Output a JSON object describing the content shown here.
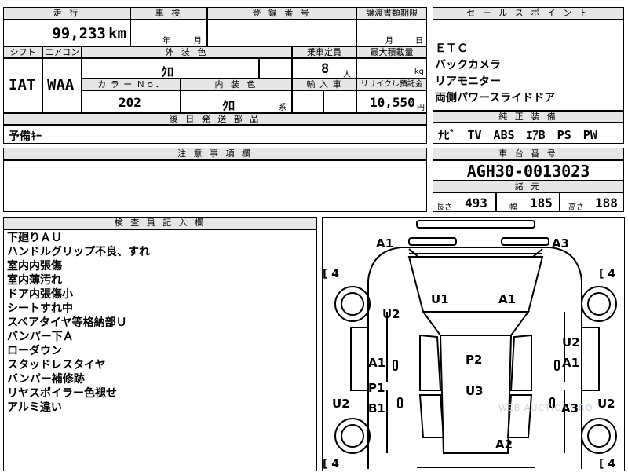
{
  "top": {
    "mileage_header": "走 行",
    "mileage_value": "99,233",
    "mileage_unit": "km",
    "inspection_header": "車 検",
    "inspection_year_label": "年",
    "inspection_month_label": "月",
    "registration_header": "登 録 番 号",
    "transfer_header": "譲渡書類期限",
    "transfer_month_label": "月",
    "transfer_day_label": "日",
    "shift_header": "シフト",
    "shift_value": "IAT",
    "aircon_header": "エアコン",
    "aircon_value": "WAA",
    "exterior_color_header": "外 装 色",
    "exterior_color_value": "ｸﾛ",
    "capacity_header": "乗車定員",
    "capacity_value": "8",
    "capacity_unit": "人",
    "max_load_header": "最大積載量",
    "max_load_unit": "kg",
    "color_no_header": "カ ラ ー Ｎｏ．",
    "color_no_value": "202",
    "interior_color_header": "内 装 色",
    "interior_color_value": "ｸﾛ",
    "interior_color_suffix": "系",
    "import_header": "輸 入 車",
    "recycle_header": "リサイクル預託金",
    "recycle_value": "10,550",
    "recycle_unit": "円",
    "parts_header": "後 日 発 送 部 品",
    "parts_value": "予備ｷｰ"
  },
  "sales": {
    "header": "セ ー ル ス ポ イ ン ト",
    "items": [
      "ＥＴＣ",
      "バックカメラ",
      "リアモニター",
      "両側パワースライドドア"
    ]
  },
  "equipment": {
    "header": "純 正 装 備",
    "value": "ﾅﾋﾞ　TV　ABS　ｴｱB　PS　PW"
  },
  "notes": {
    "header": "注 意 事 項 欄"
  },
  "chassis": {
    "header": "車 台 番 号",
    "value": "AGH30-0013023"
  },
  "dimensions": {
    "header": "諸 元",
    "length_label": "長さ",
    "length_value": "493",
    "width_label": "幅",
    "width_value": "185",
    "height_label": "高さ",
    "height_value": "188"
  },
  "inspector": {
    "header": "検 査 員 記 入 欄",
    "lines": [
      "下廻りＡＵ",
      "ハンドルグリップ不良、すれ",
      "室内内張傷",
      "室内薄汚れ",
      "ドア内張傷小",
      "シートすれ中",
      "スペアタイヤ等格納部Ｕ",
      "バンパー下Ａ",
      "ローダウン",
      "スタッドレスタイヤ",
      "バンパー補修跡",
      "リヤスポイラー色褪せ",
      "アルミ違い"
    ]
  },
  "diagram": {
    "watermark": "WEB AUCTION PRO",
    "tires": [
      "[ 4",
      "[ 4",
      "[ 4",
      "[ 4"
    ],
    "marks": {
      "front_left": "A1",
      "front_right": "A3",
      "hood_u1": "U1",
      "hood_a1": "A1",
      "left_fender": "U2",
      "right_fender_u2": "U2",
      "right_fender_a1": "A1",
      "left_door_a1": "A1",
      "left_rear_p1": "P1",
      "left_rear_b1": "B1",
      "roof_p2": "P2",
      "roof_u3": "U3",
      "left_quarter": "U2",
      "right_quarter": "U2",
      "right_rear_a3": "A3",
      "rear_a2": "A2"
    }
  }
}
